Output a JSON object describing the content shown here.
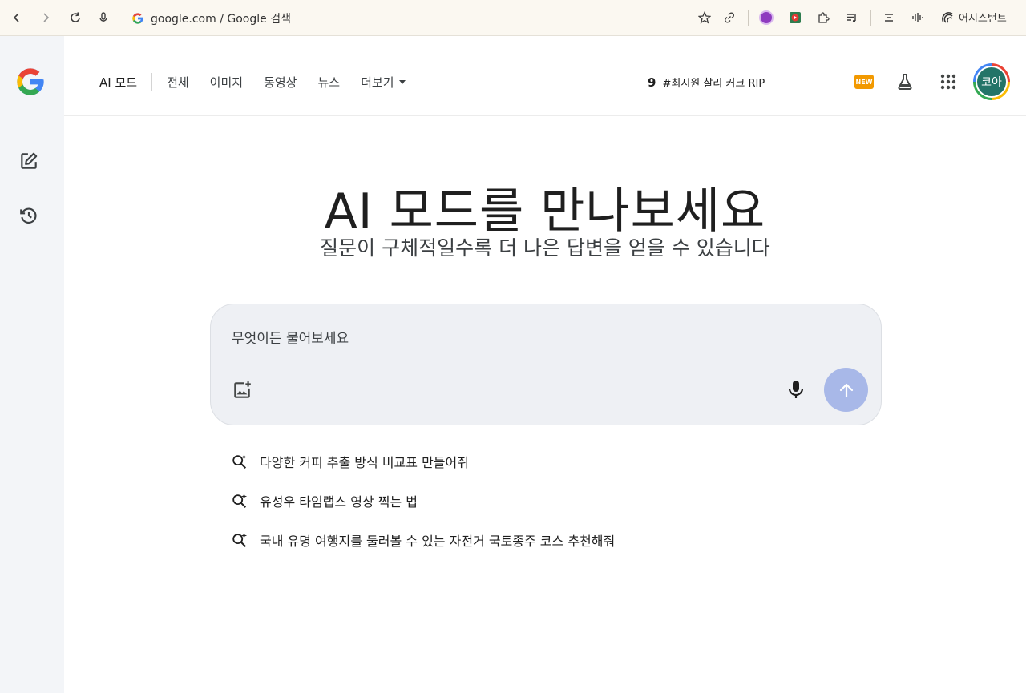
{
  "browser": {
    "address_text": "google.com / Google 검색",
    "assistant_label": "어시스턴트"
  },
  "nav": {
    "items": [
      "AI 모드",
      "전체",
      "이미지",
      "동영상",
      "뉴스",
      "더보기"
    ]
  },
  "trending": {
    "number": "9",
    "text": "#최시원 찰리 커크 RIP"
  },
  "badges": {
    "new_label": "NEW"
  },
  "avatar": {
    "label": "코아"
  },
  "hero": {
    "title": "AI 모드를 만나보세요",
    "subtitle": "질문이 구체적일수록 더 나은 답변을 얻을 수 있습니다"
  },
  "search": {
    "placeholder": "무엇이든 물어보세요"
  },
  "suggestions": [
    "다양한 커피 추출 방식 비교표 만들어줘",
    "유성우 타임랩스 영상 찍는 법",
    "국내 유명 여행지를 둘러볼 수 있는 자전거 국토종주 코스 추천해줘"
  ],
  "colors": {
    "accent": "#a8b8e8",
    "avatar_bg": "#237468",
    "rail_bg": "#f3f5f8",
    "new_badge": "#f29900"
  }
}
